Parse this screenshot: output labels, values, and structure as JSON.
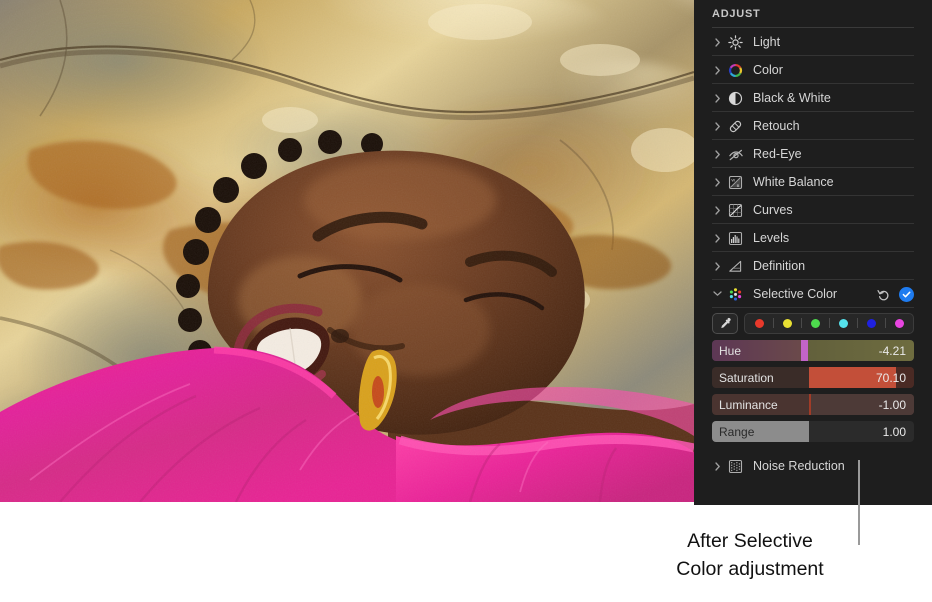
{
  "photo": {
    "alt": "Photo of a smiling woman with bantu knots lying against a golden rock, wearing a bright pink sheer top"
  },
  "panel": {
    "header": "ADJUST",
    "items": [
      {
        "label": "Light",
        "icon": "sun-icon",
        "expanded": false
      },
      {
        "label": "Color",
        "icon": "color-wheel-icon",
        "expanded": false
      },
      {
        "label": "Black & White",
        "icon": "half-circle-icon",
        "expanded": false
      },
      {
        "label": "Retouch",
        "icon": "bandage-icon",
        "expanded": false
      },
      {
        "label": "Red-Eye",
        "icon": "eye-slash-icon",
        "expanded": false
      },
      {
        "label": "White Balance",
        "icon": "white-balance-icon",
        "expanded": false
      },
      {
        "label": "Curves",
        "icon": "curves-icon",
        "expanded": false
      },
      {
        "label": "Levels",
        "icon": "levels-icon",
        "expanded": false
      },
      {
        "label": "Definition",
        "icon": "definition-icon",
        "expanded": false
      },
      {
        "label": "Selective Color",
        "icon": "selective-color-icon",
        "expanded": true
      },
      {
        "label": "Noise Reduction",
        "icon": "noise-reduction-icon",
        "expanded": false
      }
    ],
    "selective_color": {
      "title": "Selective Color",
      "reset_icon": "reset-arrow-icon",
      "enabled_icon": "checkmark-icon",
      "enabled": true,
      "accent_color": "#1f7cf0",
      "eyedropper_icon": "eyedropper-icon",
      "swatches": [
        {
          "name": "red",
          "color": "#e8392b",
          "selected": true
        },
        {
          "name": "yellow",
          "color": "#e8e033",
          "selected": false
        },
        {
          "name": "green",
          "color": "#4ddb4d",
          "selected": false
        },
        {
          "name": "cyan",
          "color": "#55e2ec",
          "selected": false
        },
        {
          "name": "blue",
          "color": "#1f21e0",
          "selected": false
        },
        {
          "name": "magenta",
          "color": "#e845e0",
          "selected": false
        }
      ],
      "sliders": [
        {
          "name": "Hue",
          "value": "-4.21",
          "fill_from": "#5d3755",
          "fill_to": "#6b4a4a",
          "rest_from": "#62603c",
          "rest_to": "#6e6c3f",
          "knob_color": "#c264c8",
          "knob_pct": 45.5,
          "style": "knob"
        },
        {
          "name": "Saturation",
          "value": "70.10",
          "fill_from": "#3a2c28",
          "fill_to": "#3a2c28",
          "rest_from": "#4a2a24",
          "rest_to": "#4a2a24",
          "bar_color": "#c34f39",
          "bar_start_pct": 48,
          "bar_end_pct": 91,
          "style": "bar"
        },
        {
          "name": "Luminance",
          "value": "-1.00",
          "fill_from": "#4a3430",
          "fill_to": "#4a3430",
          "rest_from": "#4d3a37",
          "rest_to": "#4d3a37",
          "line_color": "#a03c28",
          "line_pct": 48,
          "style": "line"
        },
        {
          "name": "Range",
          "value": "1.00",
          "fill_from": "#8c8c8c",
          "fill_to": "#8c8c8c",
          "rest_from": "#2b2b2b",
          "rest_to": "#2b2b2b",
          "fill_pct": 48,
          "style": "fill"
        }
      ]
    }
  },
  "caption": {
    "line1": "After Selective",
    "line2": "Color adjustment"
  }
}
